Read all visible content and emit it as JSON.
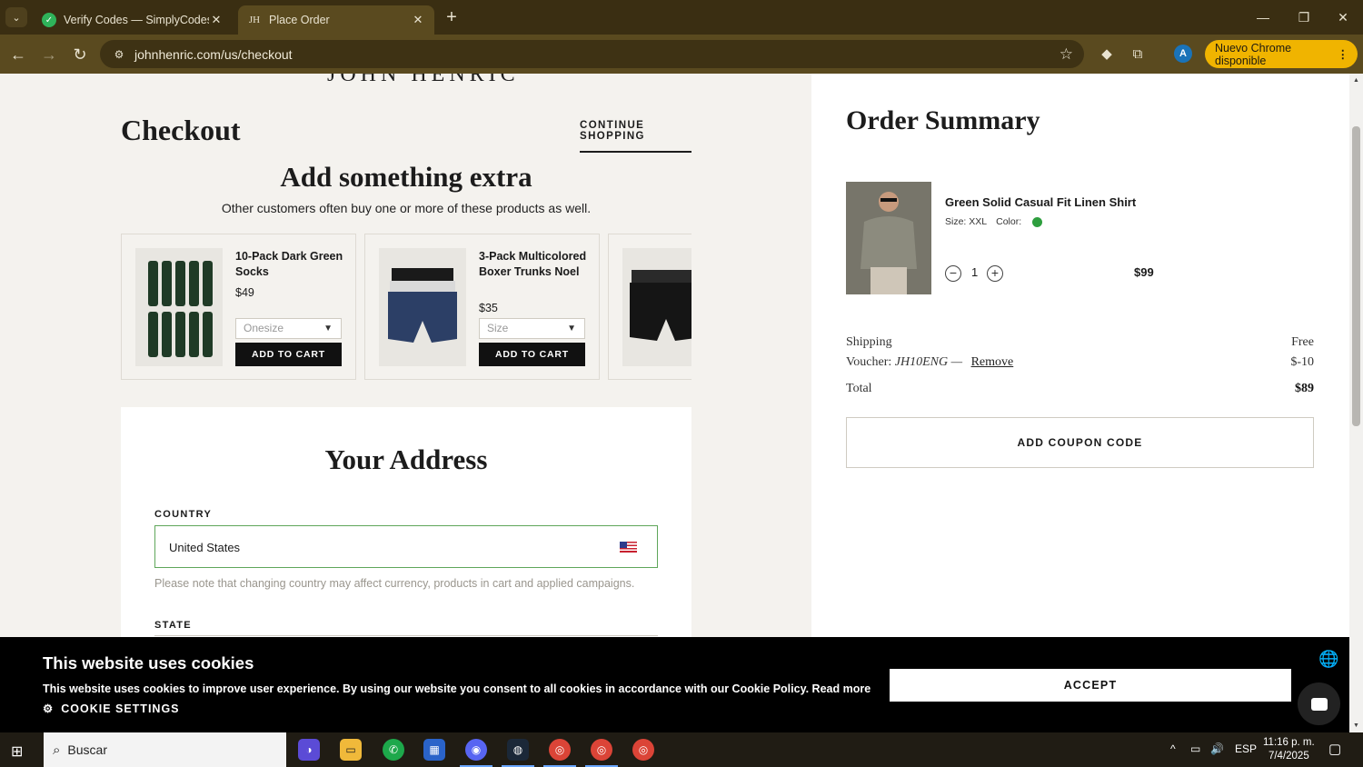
{
  "browser": {
    "tabs": [
      {
        "title": "Verify Codes — SimplyCodes",
        "active": false
      },
      {
        "title": "Place Order",
        "active": true
      }
    ],
    "url": "johnhenric.com/us/checkout",
    "update_label": "Nuevo Chrome disponible",
    "profile_initial": "A"
  },
  "page": {
    "brand_partial": "JOHN HENRIC",
    "checkout_title": "Checkout",
    "continue_label": "CONTINUE SHOPPING",
    "upsell": {
      "title": "Add something extra",
      "subtitle": "Other customers often buy one or more of these products as well.",
      "items": [
        {
          "name": "10-Pack Dark Green Socks",
          "price": "$49",
          "select": "Onesize",
          "button": "ADD TO CART"
        },
        {
          "name": "3-Pack Multicolored Boxer Trunks Noel",
          "price": "$35",
          "select": "Size",
          "button": "ADD TO CART"
        },
        {
          "name": "",
          "price": "",
          "select": "",
          "button": ""
        }
      ]
    },
    "address": {
      "title": "Your Address",
      "country_label": "COUNTRY",
      "country_value": "United States",
      "note": "Please note that changing country may affect currency, products in cart and applied campaigns.",
      "state_label": "STATE"
    },
    "summary": {
      "title": "Order Summary",
      "product": {
        "name": "Green Solid Casual Fit Linen Shirt",
        "size": "Size: XXL",
        "color_label": "Color:",
        "color": "#2e9e3e",
        "qty": "1",
        "price": "$99"
      },
      "shipping_label": "Shipping",
      "shipping_value": "Free",
      "voucher_label": "Voucher:",
      "voucher_code": "JH10ENG —",
      "remove_label": "Remove",
      "voucher_value": "$-10",
      "total_label": "Total",
      "total_value": "$89",
      "coupon_button": "ADD COUPON CODE"
    }
  },
  "cookie": {
    "title": "This website uses cookies",
    "text": "This website uses cookies to improve user experience. By using our website you consent to all cookies in accordance with our Cookie Policy. Read more",
    "settings": "COOKIE SETTINGS",
    "accept": "ACCEPT"
  },
  "taskbar": {
    "search_placeholder": "Buscar",
    "lang": "ESP",
    "time": "11:16 p. m.",
    "date": "7/4/2025"
  }
}
